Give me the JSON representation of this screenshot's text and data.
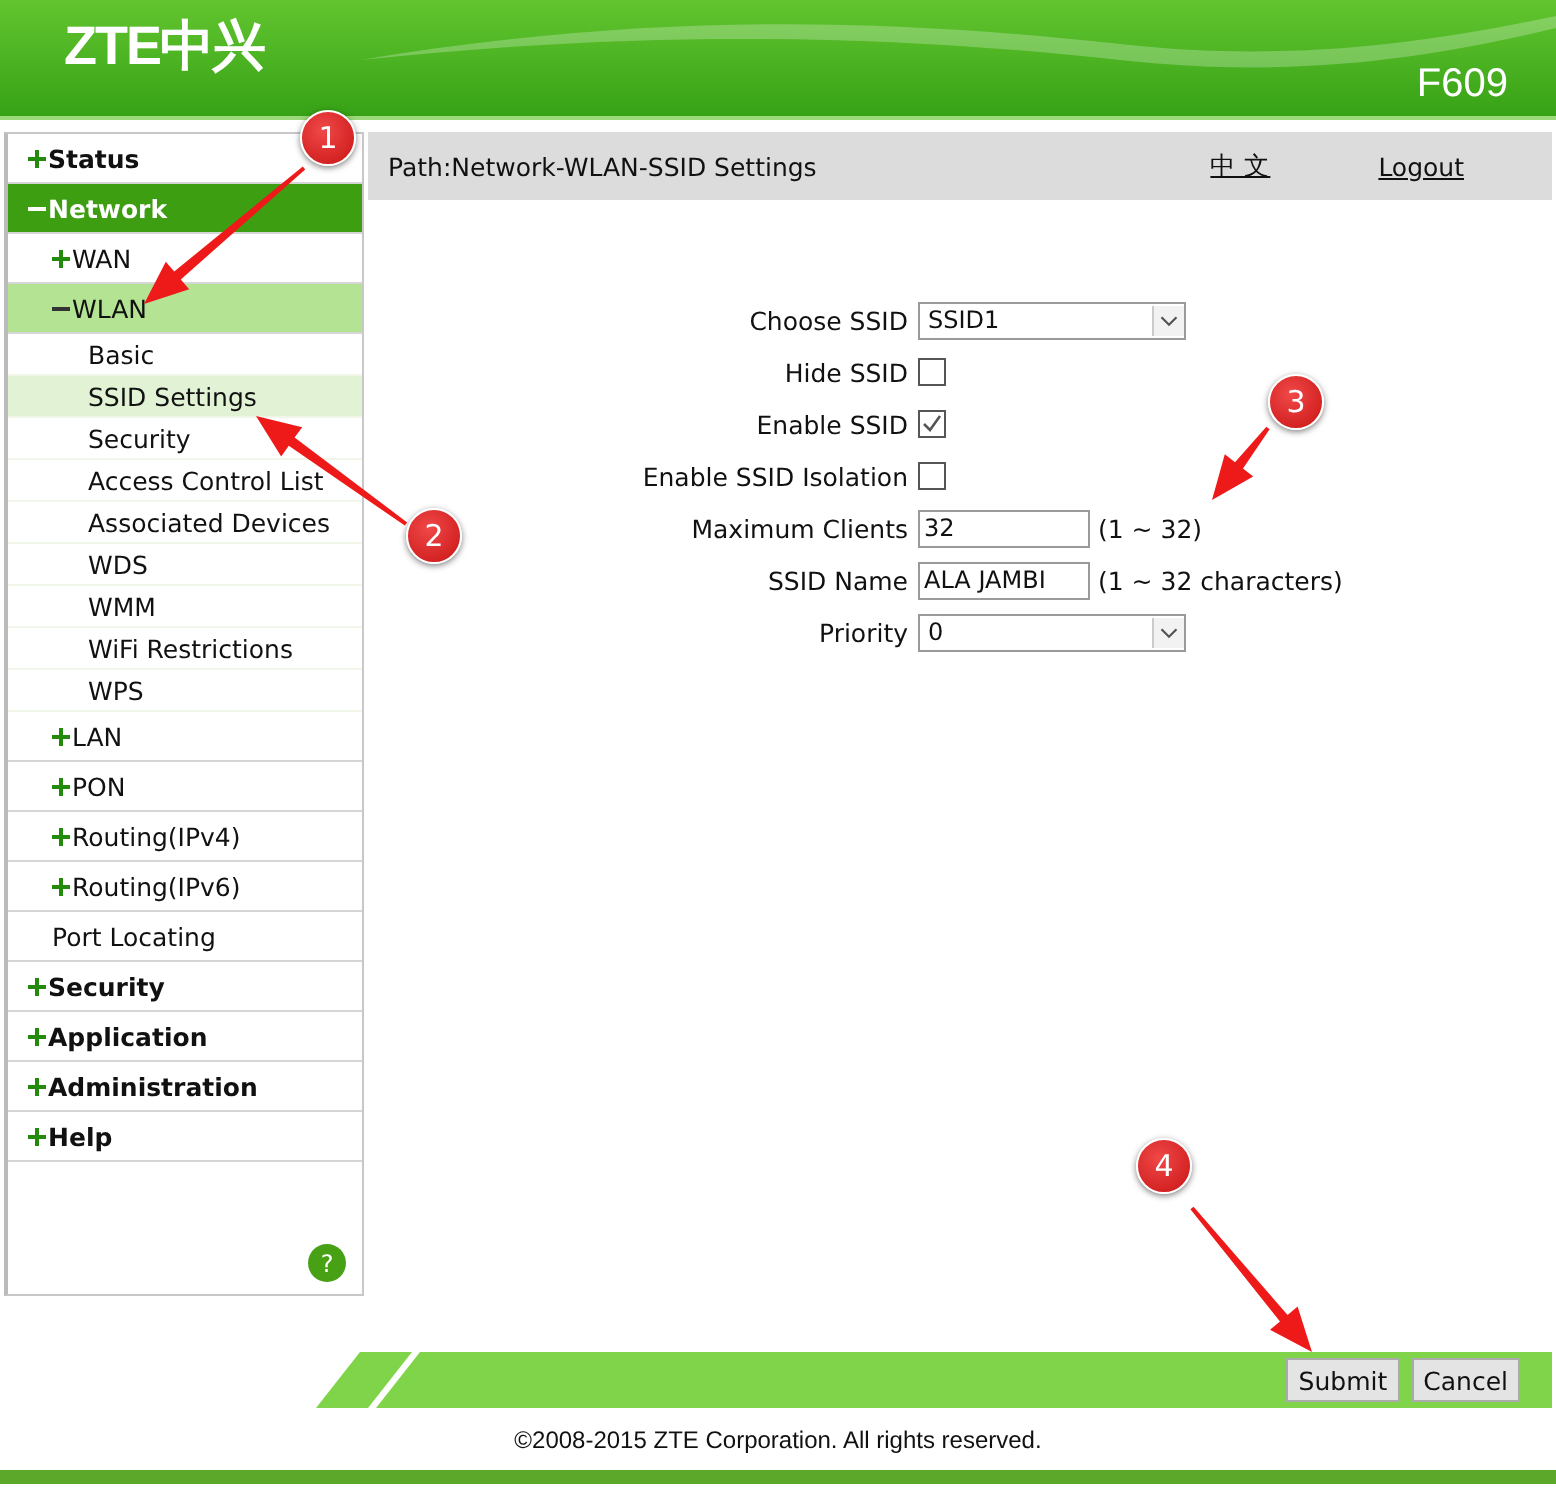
{
  "header": {
    "logo": "ZTE中兴",
    "model": "F609"
  },
  "sidebar": [
    {
      "label": "Status",
      "kind": "folder",
      "expanded": false,
      "selected": false
    },
    {
      "label": "Network",
      "kind": "folder",
      "expanded": true,
      "selected": true,
      "children": [
        {
          "label": "WAN",
          "kind": "folder",
          "expanded": false,
          "selected": false
        },
        {
          "label": "WLAN",
          "kind": "folder",
          "expanded": true,
          "selected": true,
          "children": [
            {
              "label": "Basic",
              "kind": "page",
              "selected": false
            },
            {
              "label": "SSID Settings",
              "kind": "page",
              "selected": true
            },
            {
              "label": "Security",
              "kind": "page",
              "selected": false
            },
            {
              "label": "Access Control List",
              "kind": "page",
              "selected": false
            },
            {
              "label": "Associated Devices",
              "kind": "page",
              "selected": false
            },
            {
              "label": "WDS",
              "kind": "page",
              "selected": false
            },
            {
              "label": "WMM",
              "kind": "page",
              "selected": false
            },
            {
              "label": "WiFi Restrictions",
              "kind": "page",
              "selected": false
            },
            {
              "label": "WPS",
              "kind": "page",
              "selected": false
            }
          ]
        },
        {
          "label": "LAN",
          "kind": "folder",
          "expanded": false,
          "selected": false
        },
        {
          "label": "PON",
          "kind": "folder",
          "expanded": false,
          "selected": false
        },
        {
          "label": "Routing(IPv4)",
          "kind": "folder",
          "expanded": false,
          "selected": false
        },
        {
          "label": "Routing(IPv6)",
          "kind": "folder",
          "expanded": false,
          "selected": false
        },
        {
          "label": "Port Locating",
          "kind": "page",
          "selected": false
        }
      ]
    },
    {
      "label": "Security",
      "kind": "folder",
      "expanded": false,
      "selected": false
    },
    {
      "label": "Application",
      "kind": "folder",
      "expanded": false,
      "selected": false
    },
    {
      "label": "Administration",
      "kind": "folder",
      "expanded": false,
      "selected": false
    },
    {
      "label": "Help",
      "kind": "folder",
      "expanded": false,
      "selected": false
    }
  ],
  "help": "?",
  "path_bar": {
    "path": "Path:Network-WLAN-SSID Settings",
    "language": "中 文",
    "logout": "Logout"
  },
  "form": [
    {
      "label": "Choose SSID",
      "kind": "select",
      "value": "SSID1"
    },
    {
      "label": "Hide SSID",
      "kind": "checkbox",
      "checked": false
    },
    {
      "label": "Enable SSID",
      "kind": "checkbox",
      "checked": true
    },
    {
      "label": "Enable SSID Isolation",
      "kind": "checkbox",
      "checked": false
    },
    {
      "label": "Maximum Clients",
      "kind": "input",
      "value": "32",
      "hint": "(1 ~ 32)"
    },
    {
      "label": "SSID Name",
      "kind": "input",
      "value": "ALA JAMBI",
      "hint": "(1 ~ 32 characters)"
    },
    {
      "label": "Priority",
      "kind": "select",
      "value": "0"
    }
  ],
  "buttons": [
    "Submit",
    "Cancel"
  ],
  "copyright": "©2008-2015 ZTE Corporation. All rights reserved.",
  "callouts": [
    "1",
    "2",
    "3",
    "4"
  ]
}
